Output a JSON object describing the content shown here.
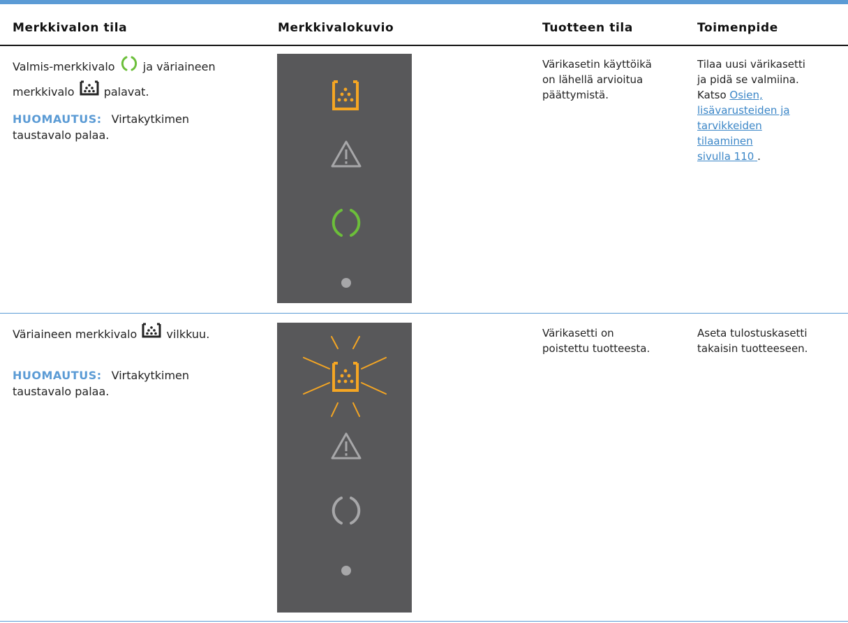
{
  "table": {
    "headers": [
      "Merkkivalon tila",
      "Merkkivalokuvio",
      "Tuotteen tila",
      "Toimenpide"
    ],
    "rows": [
      {
        "state_part1": "Valmis-merkkivalo",
        "state_part2": "ja väriaineen",
        "state_part3": "merkkivalo",
        "state_part4": "palavat.",
        "note_label": "HUOMAUTUS:",
        "note_text1": "Virtakytkimen",
        "note_text2": "taustavalo palaa.",
        "pattern": {
          "toner": "on",
          "attention": "off",
          "ready": "on",
          "power": "off"
        },
        "product_state": [
          "Värikasetin käyttöikä",
          "on lähellä arvioitua",
          "päättymistä."
        ],
        "action_text": [
          "Tilaa uusi värikasetti",
          "ja pidä se valmiina.",
          "Katso"
        ],
        "action_link": [
          "Osien,",
          "lisävarusteiden ja",
          "tarvikkeiden",
          "tilaaminen",
          "sivulla 110"
        ],
        "action_end": "."
      },
      {
        "state_part1": "Väriaineen merkkivalo",
        "state_part2": "vilkkuu.",
        "note_label": "HUOMAUTUS:",
        "note_text1": "Virtakytkimen",
        "note_text2": "taustavalo palaa.",
        "pattern": {
          "toner": "blinking",
          "attention": "off",
          "ready": "off",
          "power": "off"
        },
        "product_state": [
          "Värikasetti on",
          "poistettu tuotteesta."
        ],
        "action_text": [
          "Aseta tulostuskasetti",
          "takaisin tuotteeseen."
        ]
      }
    ]
  },
  "colors": {
    "accent": "#5b9bd5",
    "toner_on": "#f5a623",
    "ready_on": "#6cbf3a",
    "light_off": "#a7a7a9",
    "panel_bg": "#58585a"
  },
  "icons": [
    "toner-icon",
    "attention-icon",
    "ready-icon",
    "power-dot-icon"
  ]
}
